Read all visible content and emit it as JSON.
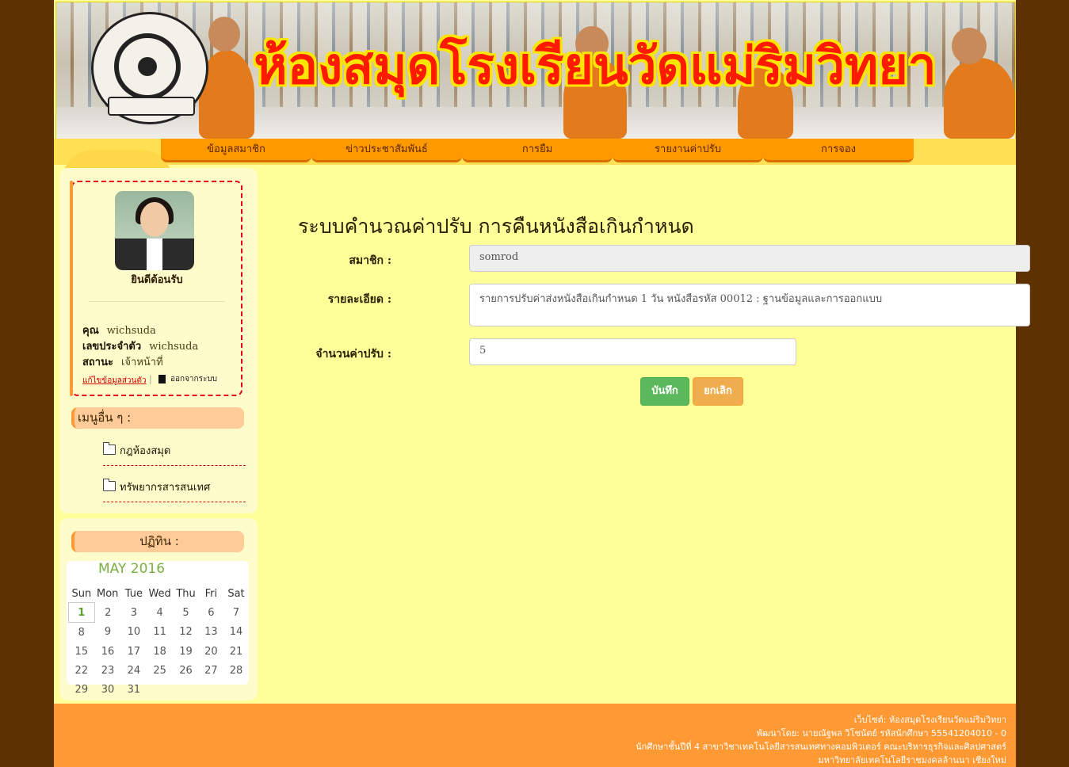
{
  "banner": {
    "title": "ห้องสมุดโรงเรียนวัดแม่ริมวิทยา"
  },
  "nav": [
    {
      "label": "ข้อมูลสมาชิก"
    },
    {
      "label": "ข่าวประชาสัมพันธ์"
    },
    {
      "label": "การยืม"
    },
    {
      "label": "รายงานค่าปรับ"
    },
    {
      "label": "การจอง"
    }
  ],
  "profile": {
    "welcome": "ยินดีต้อนรับ",
    "name_label": "คุณ",
    "name_value": "wichsuda",
    "id_label": "เลขประจำตัว",
    "id_value": "wichsuda",
    "status_label": "สถานะ",
    "status_value": "เจ้าหน้าที่",
    "edit_link": "แก้ไขข้อมูลส่วนตัว",
    "separator": "|",
    "logout": "ออกจากระบบ"
  },
  "other_menu": {
    "heading": "เมนูอื่น ๆ :",
    "items": [
      {
        "label": "กฎห้องสมุด"
      },
      {
        "label": "ทรัพยากรสารสนเทศ"
      }
    ]
  },
  "calendar": {
    "heading": "ปฏิทิน :",
    "month_label": "MAY 2016",
    "weekdays": [
      "Sun",
      "Mon",
      "Tue",
      "Wed",
      "Thu",
      "Fri",
      "Sat"
    ],
    "weeks": [
      [
        "1",
        "2",
        "3",
        "4",
        "5",
        "6",
        "7"
      ],
      [
        "8",
        "9",
        "10",
        "11",
        "12",
        "13",
        "14"
      ],
      [
        "15",
        "16",
        "17",
        "18",
        "19",
        "20",
        "21"
      ],
      [
        "22",
        "23",
        "24",
        "25",
        "26",
        "27",
        "28"
      ],
      [
        "29",
        "30",
        "31",
        "",
        "",
        "",
        ""
      ]
    ],
    "today": "1"
  },
  "form": {
    "title": "ระบบคำนวณค่าปรับ การคืนหนังสือเกินกำหนด",
    "member_label": "สมาชิก :",
    "member_value": "somrod",
    "detail_label": "รายละเอียด :",
    "detail_value": "รายการปรับค่าส่งหนังสือเกินกำหนด 1 วัน หนังสือรหัส 00012 : ฐานข้อมูลและการออกแบบ",
    "amount_label": "จำนวนค่าปรับ :",
    "amount_value": "5",
    "save_label": "บันทึก",
    "cancel_label": "ยกเลิก"
  },
  "footer": {
    "line1": "เว็บไซต์: ห้องสมุดโรงเรียนวัดแม่ริมวิทยา",
    "line2": "พัฒนาโดย: นายณัฐพล วิโชนัตย์ รหัสนักศึกษา 55541204010 - 0",
    "line3": "นักศึกษาชั้นปีที่ 4 สาขาวิชาเทคโนโลยีสารสนเทศทางคอมพิวเตอร์ คณะบริหารธุรกิจและศิลปศาสตร์",
    "line4": "มหาวิทยาลัยเทคโนโลยีราชมงคลล้านนา เชียงใหม่"
  },
  "colors": {
    "nav_button": "#ff9900",
    "page_background": "#ffff99",
    "footer": "#ff9933",
    "save_button": "#5cb85c",
    "cancel_button": "#f0ad4e",
    "outer_background": "#5e3100"
  }
}
